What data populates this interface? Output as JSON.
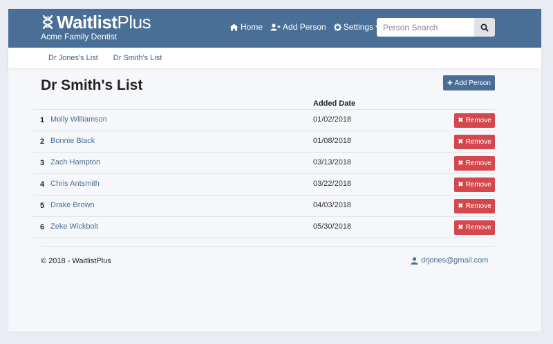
{
  "brand": {
    "name_bold": "Waitlist",
    "name_thin": "Plus",
    "subtitle": "Acme Family Dentist",
    "logo_icon": "dna-logo-icon"
  },
  "nav": {
    "home": "Home",
    "add_person": "Add Person",
    "settings": "Settings",
    "search_placeholder": "Person Search"
  },
  "subnav": {
    "items": [
      "Dr Jones's List",
      "Dr Smith's List"
    ]
  },
  "page": {
    "title": "Dr Smith's List",
    "add_button": "Add Person",
    "date_header": "Added Date",
    "remove_label": "Remove"
  },
  "rows": [
    {
      "num": "1",
      "name": "Molly Williamson",
      "date": "01/02/2018"
    },
    {
      "num": "2",
      "name": "Bonnie Black",
      "date": "01/08/2018"
    },
    {
      "num": "3",
      "name": "Zach Hampton",
      "date": "03/13/2018"
    },
    {
      "num": "4",
      "name": "Chris Antsmith",
      "date": "03/22/2018"
    },
    {
      "num": "5",
      "name": "Drake Brown",
      "date": "04/03/2018"
    },
    {
      "num": "6",
      "name": "Zeke Wickbolt",
      "date": "05/30/2018"
    }
  ],
  "footer": {
    "copyright": "© 2018 - WaitlistPlus",
    "user_email": "drjones@gmail.com"
  },
  "colors": {
    "primary": "#4a6f96",
    "danger": "#d3474d",
    "background": "#f5f7fa"
  }
}
